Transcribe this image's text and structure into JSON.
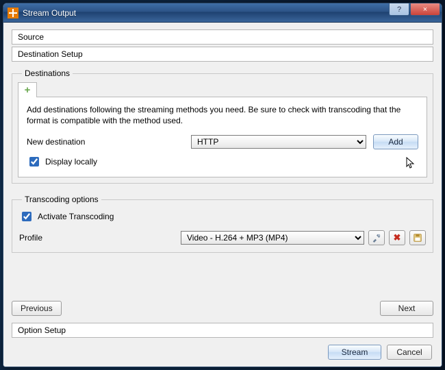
{
  "window": {
    "title": "Stream Output",
    "help_label": "?",
    "close_label": "×"
  },
  "sections": {
    "source": "Source",
    "destination_setup": "Destination Setup",
    "option_setup": "Option Setup"
  },
  "destinations": {
    "legend": "Destinations",
    "plus_label": "+",
    "description": "Add destinations following the streaming methods you need. Be sure to check with transcoding that the format is compatible with the method used.",
    "new_destination_label": "New destination",
    "selected_method": "HTTP",
    "add_button": "Add",
    "display_locally_label": "Display locally",
    "display_locally_checked": true
  },
  "transcoding": {
    "legend": "Transcoding options",
    "activate_label": "Activate Transcoding",
    "activate_checked": true,
    "profile_label": "Profile",
    "selected_profile": "Video - H.264 + MP3 (MP4)",
    "tool_edit_icon": "tools-icon",
    "tool_delete_label": "✖",
    "tool_save_icon": "save-icon"
  },
  "nav": {
    "previous": "Previous",
    "next": "Next"
  },
  "footer": {
    "stream": "Stream",
    "cancel": "Cancel"
  }
}
